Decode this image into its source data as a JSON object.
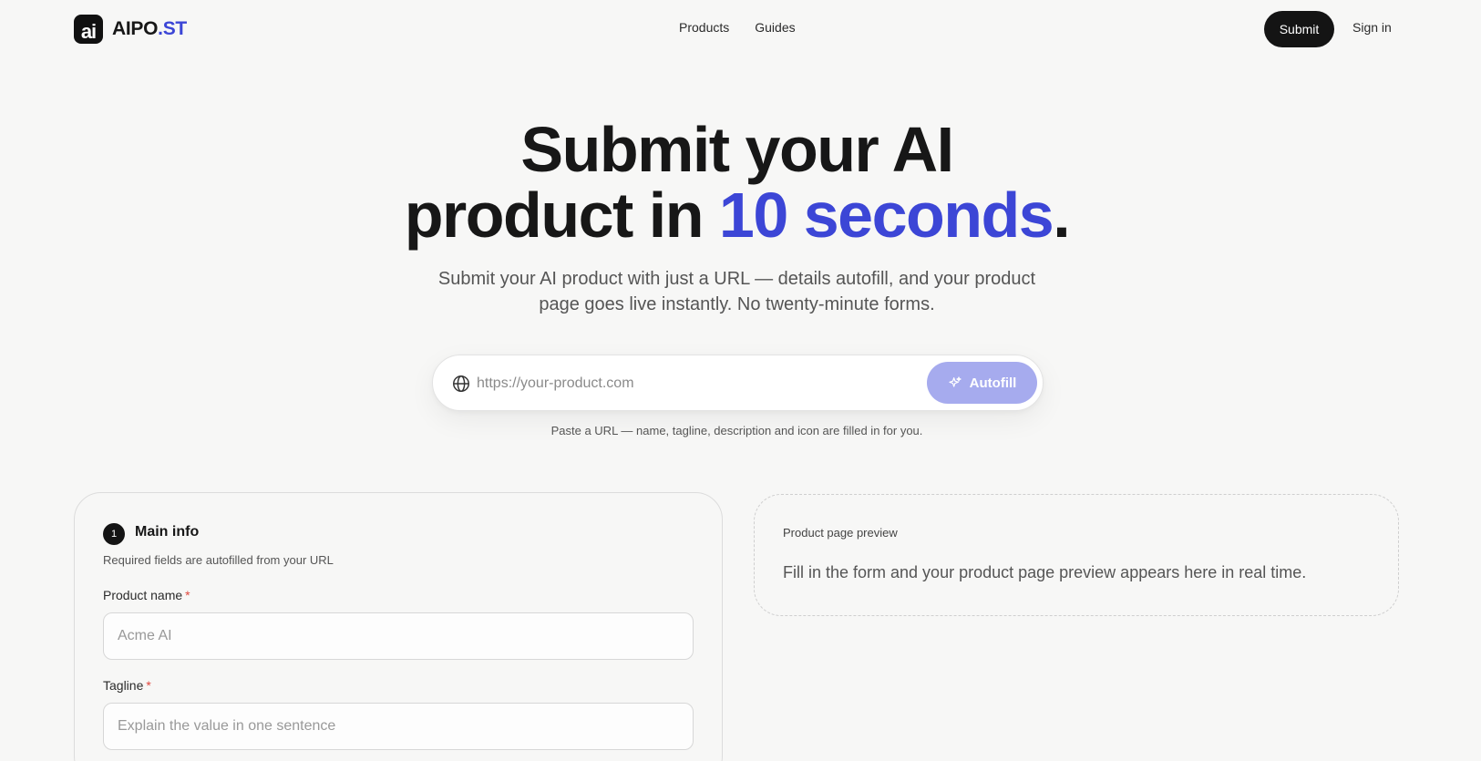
{
  "header": {
    "logo_mark": "ai",
    "logo_text_main": "AIPO",
    "logo_text_accent": ".ST",
    "nav": [
      "Products",
      "Guides"
    ],
    "submit_label": "Submit",
    "signin_label": "Sign in"
  },
  "hero": {
    "title_line1": "Submit your AI",
    "title_line2_pre": "product in ",
    "title_line2_highlight": "10 seconds",
    "title_line2_post": ".",
    "subtitle": "Submit your AI product with just a URL — details autofill, and your product page goes live instantly. No twenty-minute forms.",
    "url_placeholder": "https://your-product.com",
    "autofill_label": "Autofill",
    "hint": "Paste a URL — name, tagline, description and icon are filled in for you."
  },
  "form": {
    "step": "1",
    "title": "Main info",
    "subtitle": "Required fields are autofilled from your URL",
    "fields": [
      {
        "label": "Product name",
        "required_mark": "*",
        "placeholder": "Acme AI"
      },
      {
        "label": "Tagline",
        "required_mark": "*",
        "placeholder": "Explain the value in one sentence"
      }
    ]
  },
  "preview": {
    "label": "Product page preview",
    "text": "Fill in the form and your product page preview appears here in real time."
  },
  "colors": {
    "accent": "#3c46d6",
    "autofill_button": "#a6abee",
    "required": "#e0483e",
    "background": "#f7f7f6"
  },
  "icons": [
    "globe-icon",
    "sparkle-icon"
  ]
}
